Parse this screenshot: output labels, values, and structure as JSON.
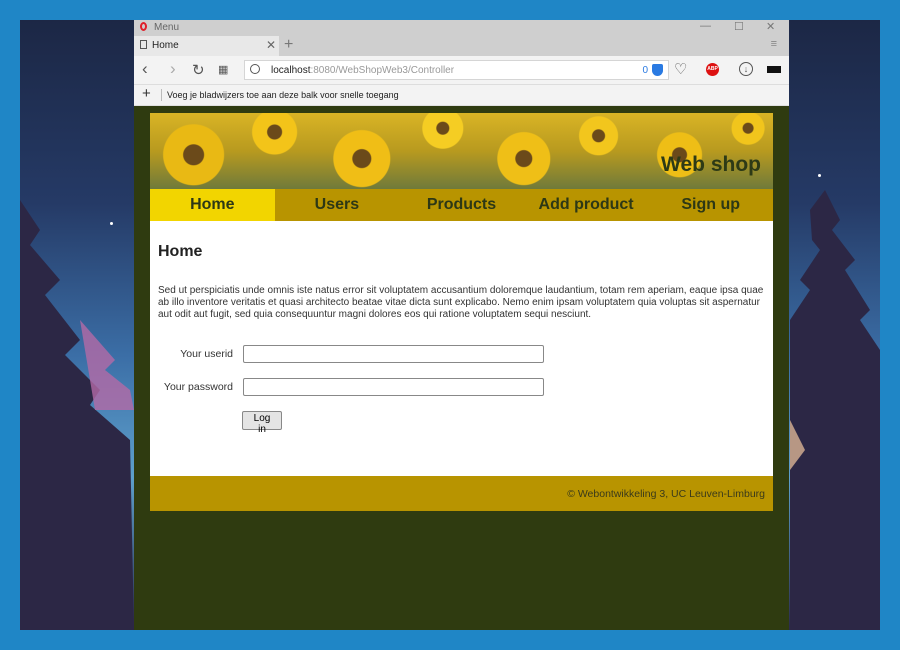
{
  "browser": {
    "menu_label": "Menu",
    "tab_title": "Home",
    "url_host": "localhost",
    "url_path": ":8080/WebShopWeb3/Controller",
    "blocked_count": "0",
    "bookmarks_hint": "Voeg je bladwijzers toe aan deze balk voor snelle toegang",
    "abp_label": "ABP"
  },
  "site": {
    "banner_title": "Web shop",
    "nav": [
      "Home",
      "Users",
      "Products",
      "Add product",
      "Sign up"
    ],
    "active_nav": "Home",
    "heading": "Home",
    "intro": "Sed ut perspiciatis unde omnis iste natus error sit voluptatem accusantium doloremque laudantium, totam rem aperiam, eaque ipsa quae ab illo inventore veritatis et quasi architecto beatae vitae dicta sunt explicabo. Nemo enim ipsam voluptatem quia voluptas sit aspernatur aut odit aut fugit, sed quia consequuntur magni dolores eos qui ratione voluptatem sequi nesciunt.",
    "form": {
      "userid_label": "Your userid",
      "userid_value": "",
      "password_label": "Your password",
      "password_value": "",
      "submit_label": "Log in"
    },
    "footer": "© Webontwikkeling 3, UC Leuven-Limburg"
  },
  "colors": {
    "nav_bg": "#b89400",
    "nav_active": "#f2d500",
    "page_bg": "#2f3b10",
    "desktop_frame": "#1f86c6"
  }
}
